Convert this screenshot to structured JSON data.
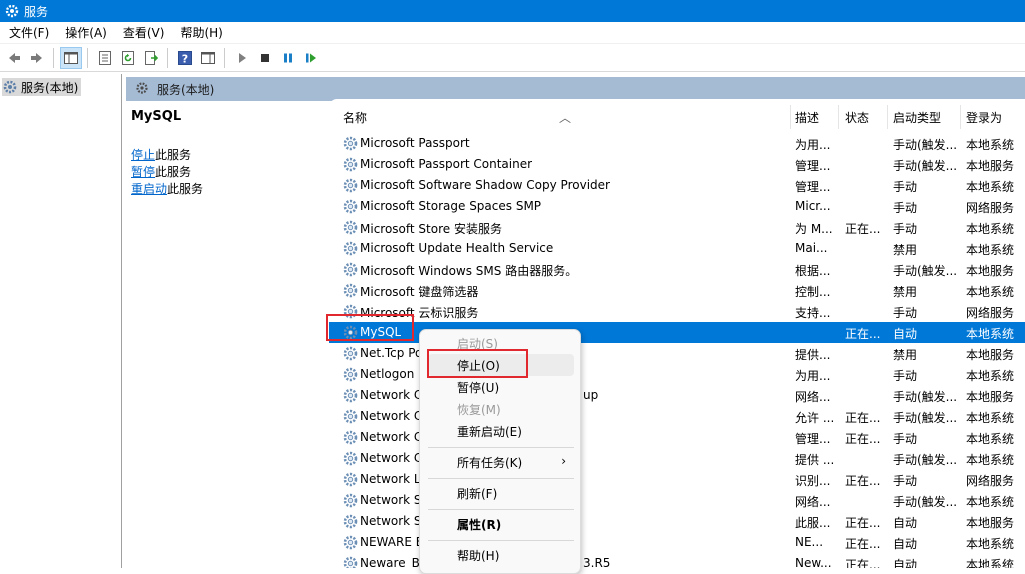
{
  "window": {
    "title": "服务"
  },
  "menu": [
    "文件(F)",
    "操作(A)",
    "查看(V)",
    "帮助(H)"
  ],
  "tree": {
    "root": "服务(本地)"
  },
  "scope": {
    "title": "服务(本地)"
  },
  "details": {
    "service_name": "MySQL",
    "links": [
      {
        "link": "停止",
        "rest": "此服务"
      },
      {
        "link": "暂停",
        "rest": "此服务"
      },
      {
        "link": "重启动",
        "rest": "此服务"
      }
    ]
  },
  "columns": {
    "name": "名称",
    "desc": "描述",
    "state": "状态",
    "start_type": "启动类型",
    "logon": "登录为"
  },
  "rows": [
    {
      "name": "Microsoft Passport",
      "desc": "为用...",
      "state": "",
      "start_type": "手动(触发...",
      "logon": "本地系统"
    },
    {
      "name": "Microsoft Passport Container",
      "desc": "管理...",
      "state": "",
      "start_type": "手动(触发...",
      "logon": "本地服务"
    },
    {
      "name": "Microsoft Software Shadow Copy Provider",
      "desc": "管理...",
      "state": "",
      "start_type": "手动",
      "logon": "本地系统"
    },
    {
      "name": "Microsoft Storage Spaces SMP",
      "desc": "Micr...",
      "state": "",
      "start_type": "手动",
      "logon": "网络服务"
    },
    {
      "name": "Microsoft Store 安装服务",
      "desc": "为 M...",
      "state": "正在...",
      "start_type": "手动",
      "logon": "本地系统"
    },
    {
      "name": "Microsoft Update Health Service",
      "desc": "Mai...",
      "state": "",
      "start_type": "禁用",
      "logon": "本地系统"
    },
    {
      "name": "Microsoft Windows SMS 路由器服务。",
      "desc": "根据...",
      "state": "",
      "start_type": "手动(触发...",
      "logon": "本地服务"
    },
    {
      "name": "Microsoft 键盘筛选器",
      "desc": "控制...",
      "state": "",
      "start_type": "禁用",
      "logon": "本地系统"
    },
    {
      "name": "Microsoft 云标识服务",
      "desc": "支持...",
      "state": "",
      "start_type": "手动",
      "logon": "网络服务"
    },
    {
      "name": "MySQL",
      "desc": "",
      "state": "正在...",
      "start_type": "自动",
      "logon": "本地系统",
      "selected": true
    },
    {
      "name": "Net.Tcp Po",
      "desc": "提供...",
      "state": "",
      "start_type": "禁用",
      "logon": "本地服务"
    },
    {
      "name": "Netlogon",
      "desc": "为用...",
      "state": "",
      "start_type": "手动",
      "logon": "本地系统"
    },
    {
      "name": "Network C",
      "name_tail": "up",
      "desc": "网络...",
      "state": "",
      "start_type": "手动(触发...",
      "logon": "本地服务"
    },
    {
      "name": "Network C",
      "desc": "允许 ...",
      "state": "正在...",
      "start_type": "手动(触发...",
      "logon": "本地系统"
    },
    {
      "name": "Network C",
      "desc": "管理...",
      "state": "正在...",
      "start_type": "手动",
      "logon": "本地系统"
    },
    {
      "name": "Network C",
      "desc": "提供 ...",
      "state": "",
      "start_type": "手动(触发...",
      "logon": "本地系统"
    },
    {
      "name": "Network L",
      "desc": "识别...",
      "state": "正在...",
      "start_type": "手动",
      "logon": "网络服务"
    },
    {
      "name": "Network S",
      "desc": "网络...",
      "state": "",
      "start_type": "手动(触发...",
      "logon": "本地系统"
    },
    {
      "name": "Network S",
      "desc": "此服...",
      "state": "正在...",
      "start_type": "自动",
      "logon": "本地服务"
    },
    {
      "name": "NEWARE E",
      "desc": "NE...",
      "state": "正在...",
      "start_type": "自动",
      "logon": "本地系统"
    },
    {
      "name": "Neware_B",
      "name_tail": "3.R5",
      "desc": "New...",
      "state": "正在...",
      "start_type": "自动",
      "logon": "本地系统"
    }
  ],
  "context_menu": [
    {
      "label": "启动(S)",
      "disabled": true
    },
    {
      "label": "停止(O)",
      "hover": true
    },
    {
      "label": "暂停(U)"
    },
    {
      "label": "恢复(M)",
      "disabled": true
    },
    {
      "label": "重新启动(E)"
    },
    {
      "label": "所有任务(K)",
      "submenu": true
    },
    {
      "label": "刷新(F)"
    },
    {
      "label": "属性(R)",
      "bold": true
    },
    {
      "label": "帮助(H)"
    }
  ],
  "colors": {
    "title_bar": "#0078d7",
    "selection": "#0078d7",
    "highlight_box": "#e0282e",
    "scope_header": "#a5bbd4"
  }
}
